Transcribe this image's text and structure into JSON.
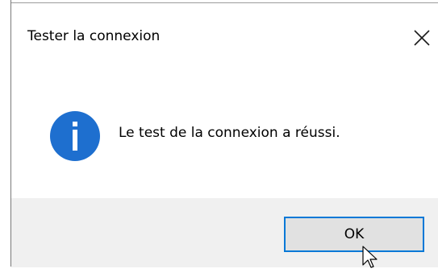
{
  "dialog": {
    "title": "Tester la connexion",
    "message": "Le test de la connexion a réussi.",
    "ok_label": "OK"
  },
  "icons": {
    "close": "close-icon",
    "info": "info-icon",
    "cursor": "mouse-pointer-icon"
  },
  "colors": {
    "accent": "#0078d7",
    "info_icon": "#1e6fcf",
    "footer_bg": "#f0f0f0",
    "button_bg": "#e1e1e1"
  }
}
